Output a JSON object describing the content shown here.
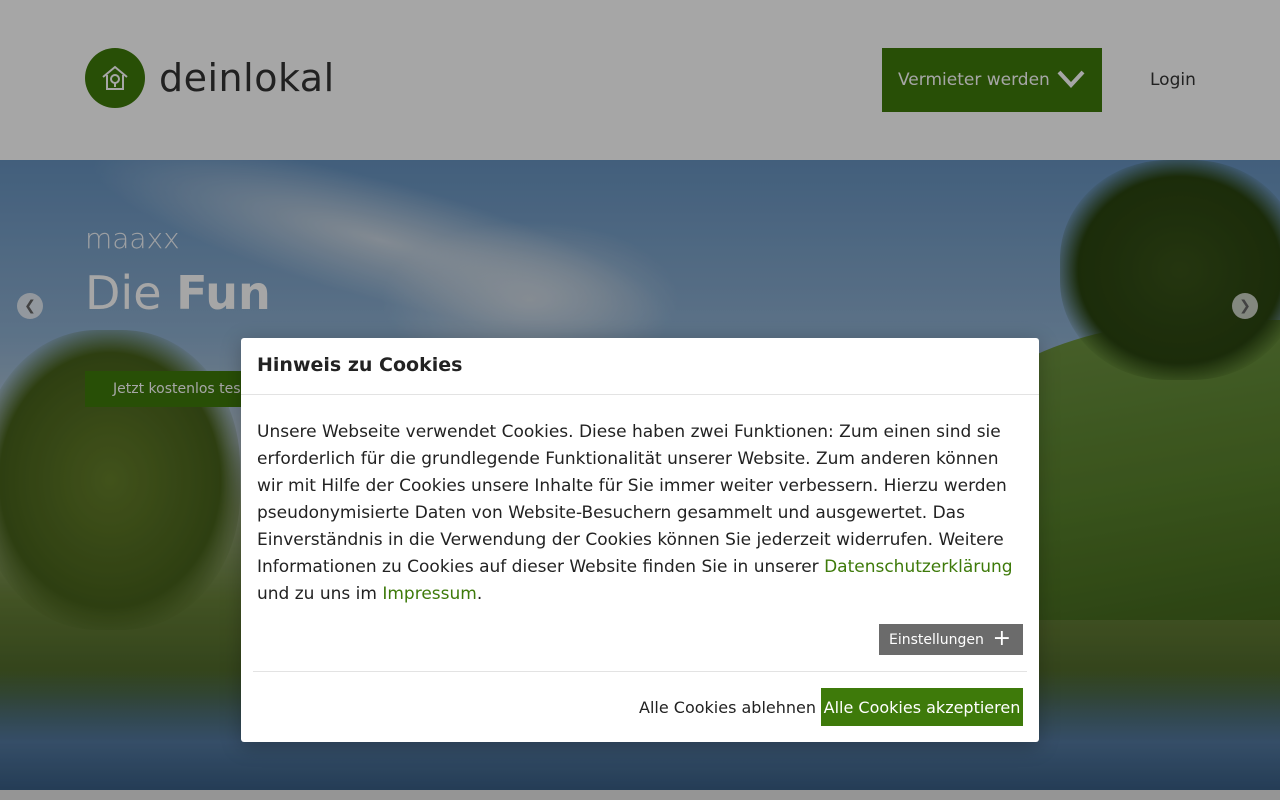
{
  "header": {
    "logo_text": "deinlokal",
    "vermieter_label": "Vermieter werden",
    "login_label": "Login"
  },
  "hero": {
    "subtitle": "maaxx",
    "title_plain": "Die ",
    "title_bold": "Fun",
    "cta_label": "Jetzt kostenlos tes"
  },
  "cookie_modal": {
    "title": "Hinweis zu Cookies",
    "body_part1": "Unsere Webseite verwendet Cookies. Diese haben zwei Funktionen: Zum einen sind sie erforderlich für die grundlegende Funktionalität unserer Website. Zum anderen können wir mit Hilfe der Cookies unsere Inhalte für Sie immer weiter verbessern. Hierzu werden pseudonymisierte Daten von Website-Besuchern gesammelt und ausgewertet. Das Einverständnis in die Verwendung der Cookies können Sie jederzeit widerrufen. Weitere Informationen zu Cookies auf dieser Website finden Sie in unserer ",
    "privacy_link": "Datenschutzerklärung",
    "body_part2": " und zu uns im ",
    "imprint_link": "Impressum",
    "body_part3": ".",
    "settings_label": "Einstellungen",
    "reject_label": "Alle Cookies ablehnen",
    "accept_label": "Alle Cookies akzeptieren"
  },
  "colors": {
    "brand_green": "#3e7a0a",
    "settings_gray": "#6b6b6b"
  },
  "icons": {
    "logo": "house-location-icon",
    "dropdown": "chevron-down-icon",
    "prev": "chevron-left-icon",
    "next": "chevron-right-icon",
    "settings": "plus-icon"
  }
}
